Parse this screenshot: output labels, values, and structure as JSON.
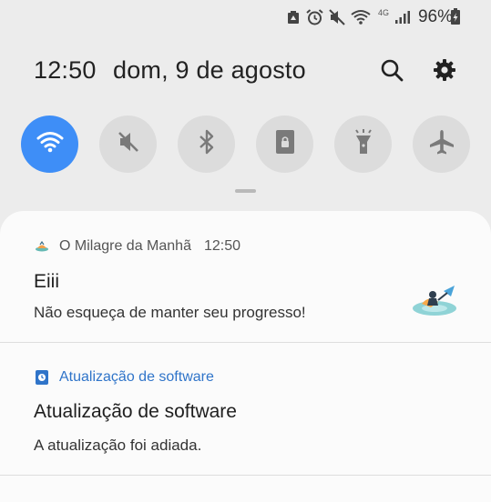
{
  "status_bar": {
    "network_label": "4G",
    "battery_percent": "96%",
    "icons": [
      "data-saver-icon",
      "alarm-icon",
      "mute-icon",
      "wifi-icon",
      "signal-icon",
      "battery-charging-icon"
    ]
  },
  "header": {
    "time": "12:50",
    "date": "dom, 9 de agosto",
    "search_icon": "search-icon",
    "settings_icon": "gear-icon"
  },
  "quick_settings": [
    {
      "name": "wifi",
      "icon": "wifi-icon",
      "active": true
    },
    {
      "name": "sound",
      "icon": "mute-icon",
      "active": false
    },
    {
      "name": "bluetooth",
      "icon": "bluetooth-icon",
      "active": false
    },
    {
      "name": "portrait-lock",
      "icon": "rotation-lock-icon",
      "active": false
    },
    {
      "name": "flashlight",
      "icon": "flashlight-icon",
      "active": false
    },
    {
      "name": "airplane-mode",
      "icon": "airplane-icon",
      "active": false
    }
  ],
  "notifications": [
    {
      "app": "O Milagre da Manhã",
      "time": "12:50",
      "title": "Eiii",
      "text": "Não esqueça de manter seu progresso!"
    },
    {
      "app": "Atualização de software",
      "title": "Atualização de software",
      "text": "A atualização foi adiada."
    }
  ],
  "colors": {
    "accent": "#3e8ef7",
    "tile_off": "#dcdcdc",
    "background": "#ececec",
    "panel": "#fbfbfb",
    "update_app_color": "#2f74c9"
  }
}
